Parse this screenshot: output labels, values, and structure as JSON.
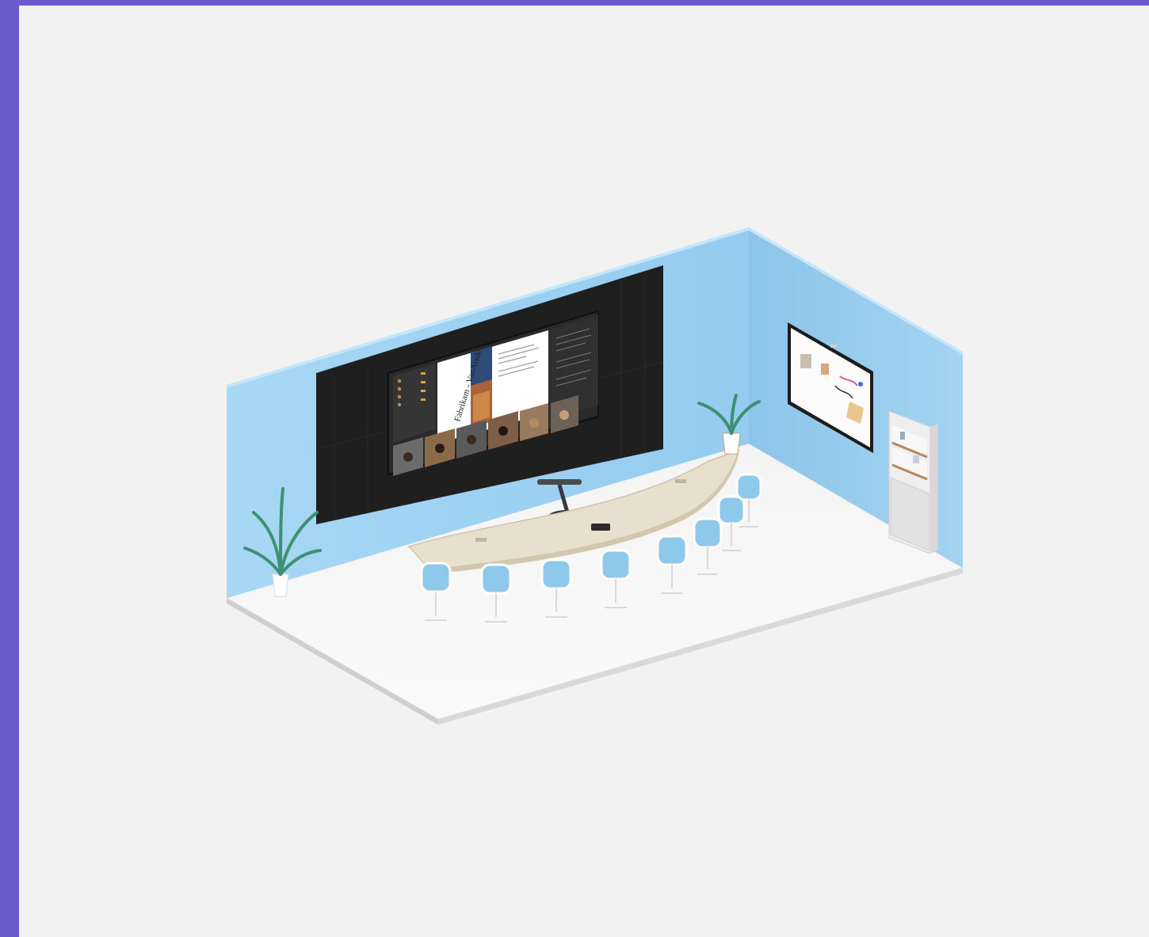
{
  "colors": {
    "frame": "#6a5acd",
    "background": "#f2f2f2",
    "wall_back": "#9fd3f2",
    "wall_side": "#8fc7ec",
    "floor": "#f7f7f7",
    "panel": "#1e1e1e",
    "table": "#e9e0cf",
    "chair": "#8ec8ea"
  },
  "scene": {
    "front_display": {
      "slide_title": "Fabrikam - VanArsdel"
    },
    "icons": [
      "plant-icon",
      "chair-icon",
      "camera-icon",
      "shelf-icon"
    ]
  }
}
